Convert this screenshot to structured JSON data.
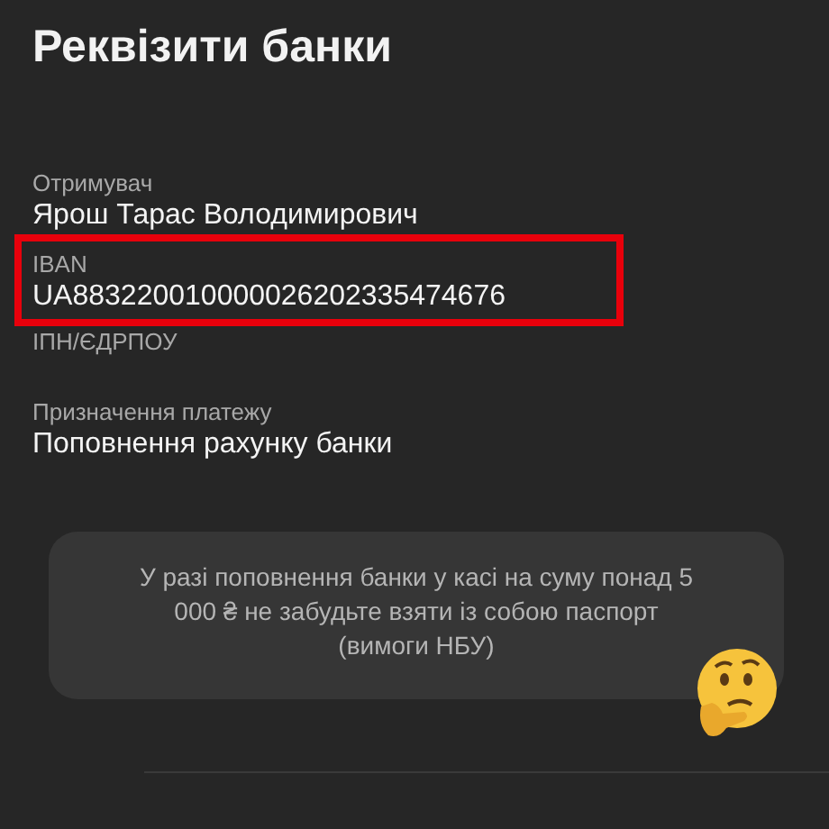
{
  "title": "Реквізити банки",
  "fields": [
    {
      "label": "Отримувач",
      "value": "Ярош Тарас Володимирович",
      "highlighted": false
    },
    {
      "label": "IBAN",
      "value": "UA883220010000026202335474676",
      "highlighted": true
    },
    {
      "label": "ІПН/ЄДРПОУ",
      "highlighted": false
    },
    {
      "label": "Призначення платежу",
      "value": "Поповнення рахунку банки",
      "highlighted": false
    }
  ],
  "notice": {
    "text": "У разі поповнення банки у касі на суму понад 5 000 ₴ не забудьте взяти із собою паспорт (вимоги НБУ)"
  }
}
